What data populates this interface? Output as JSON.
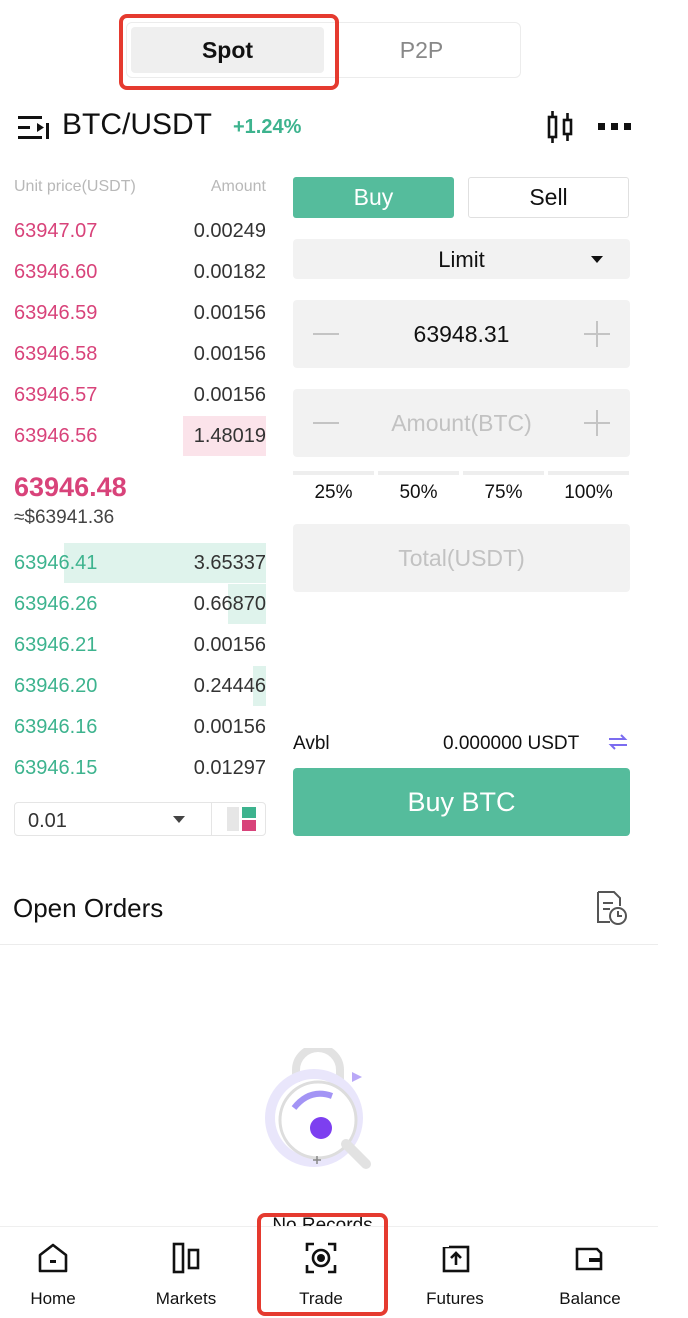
{
  "mode_tabs": {
    "spot": "Spot",
    "p2p": "P2P"
  },
  "pair": {
    "symbol": "BTC/USDT",
    "change": "+1.24%"
  },
  "order_book": {
    "price_header": "Unit price(USDT)",
    "amount_header": "Amount",
    "asks": [
      {
        "price": "63947.07",
        "amount": "0.00249",
        "depth": 0
      },
      {
        "price": "63946.60",
        "amount": "0.00182",
        "depth": 0
      },
      {
        "price": "63946.59",
        "amount": "0.00156",
        "depth": 0
      },
      {
        "price": "63946.58",
        "amount": "0.00156",
        "depth": 0
      },
      {
        "price": "63946.57",
        "amount": "0.00156",
        "depth": 0
      },
      {
        "price": "63946.56",
        "amount": "1.48019",
        "depth": 0.33
      }
    ],
    "last_price": "63946.48",
    "last_price_fiat": "≈$63941.36",
    "bids": [
      {
        "price": "63946.41",
        "amount": "3.65337",
        "depth": 0.8
      },
      {
        "price": "63946.26",
        "amount": "0.66870",
        "depth": 0.15
      },
      {
        "price": "63946.21",
        "amount": "0.00156",
        "depth": 0
      },
      {
        "price": "63946.20",
        "amount": "0.24446",
        "depth": 0.05
      },
      {
        "price": "63946.16",
        "amount": "0.00156",
        "depth": 0
      },
      {
        "price": "63946.15",
        "amount": "0.01297",
        "depth": 0
      }
    ],
    "precision": "0.01"
  },
  "trade_form": {
    "buy_label": "Buy",
    "sell_label": "Sell",
    "order_type": "Limit",
    "price_value": "63948.31",
    "amount_placeholder": "Amount(BTC)",
    "percentages": [
      "25%",
      "50%",
      "75%",
      "100%"
    ],
    "total_placeholder": "Total(USDT)",
    "avbl_label": "Avbl",
    "avbl_value": "0.000000 USDT",
    "submit_label": "Buy BTC"
  },
  "open_orders": {
    "title": "Open Orders",
    "empty_text": "No Records"
  },
  "bottom_nav": [
    {
      "label": "Home",
      "icon": "home-icon"
    },
    {
      "label": "Markets",
      "icon": "markets-icon"
    },
    {
      "label": "Trade",
      "icon": "trade-icon"
    },
    {
      "label": "Futures",
      "icon": "futures-icon"
    },
    {
      "label": "Balance",
      "icon": "wallet-icon"
    }
  ],
  "colors": {
    "buy_green": "#55bc9c",
    "bid_green": "#3db38e",
    "ask_red": "#d8437a",
    "highlight": "#e53a2f"
  }
}
